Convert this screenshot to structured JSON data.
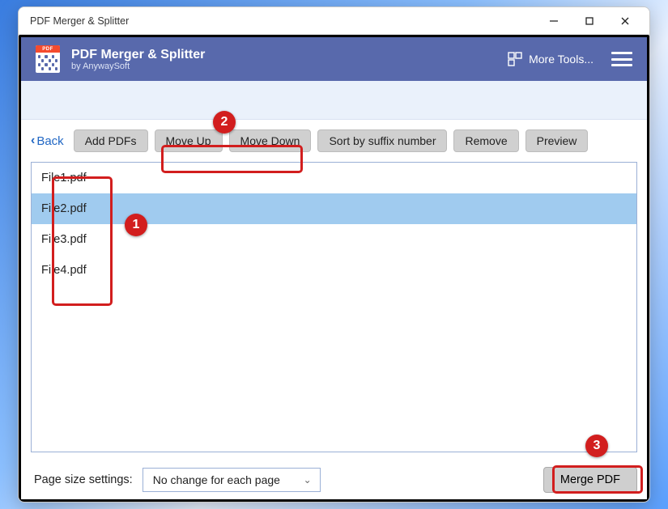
{
  "window": {
    "title": "PDF Merger & Splitter"
  },
  "app": {
    "title": "PDF Merger & Splitter",
    "subtitle": "by AnywaySoft",
    "moreTools": "More Tools..."
  },
  "toolbar": {
    "back": "Back",
    "addPDFs": "Add PDFs",
    "moveUp": "Move Up",
    "moveDown": "Move Down",
    "sortBySuffix": "Sort by suffix number",
    "remove": "Remove",
    "preview": "Preview"
  },
  "files": [
    {
      "name": "File1.pdf",
      "selected": false
    },
    {
      "name": "File2.pdf",
      "selected": true
    },
    {
      "name": "File3.pdf",
      "selected": false
    },
    {
      "name": "File4.pdf",
      "selected": false
    }
  ],
  "bottom": {
    "pageSizeLabel": "Page size settings:",
    "pageSizeValue": "No change for each page",
    "mergeBtn": "Merge PDF"
  },
  "callouts": {
    "c1": "1",
    "c2": "2",
    "c3": "3"
  }
}
